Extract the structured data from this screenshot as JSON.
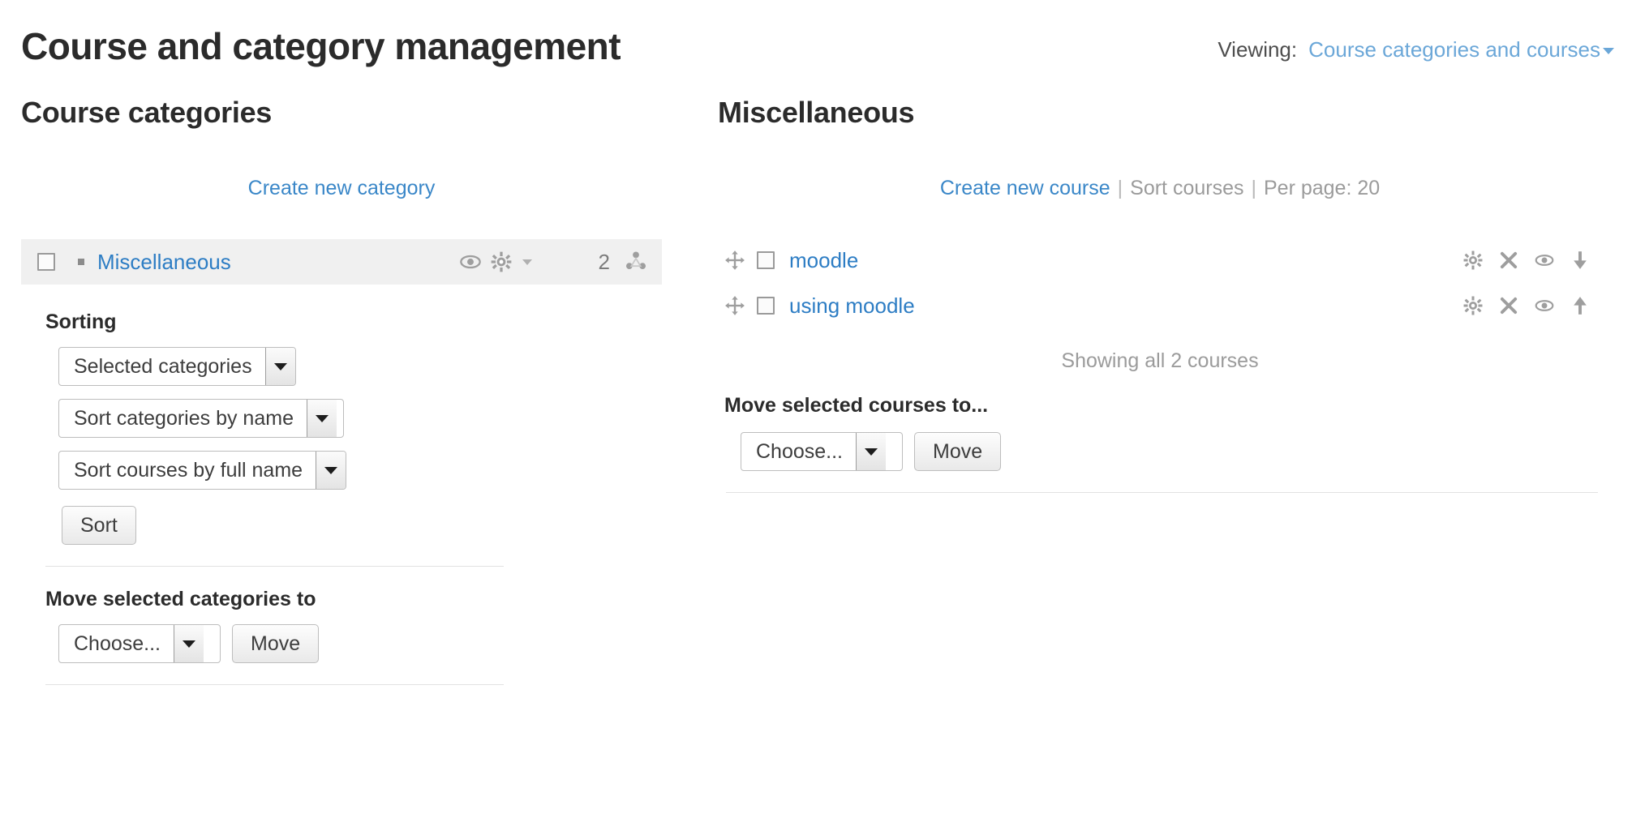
{
  "header": {
    "title": "Course and category management",
    "viewing_label": "Viewing:",
    "viewing_value": "Course categories and courses"
  },
  "categories_panel": {
    "heading": "Course categories",
    "create_link": "Create new category",
    "rows": [
      {
        "name": "Miscellaneous",
        "course_count": "2",
        "selected": true
      }
    ],
    "sorting": {
      "heading": "Sorting",
      "select_scope": "Selected categories",
      "select_categories_by": "Sort categories by name",
      "select_courses_by": "Sort courses by full name",
      "sort_button": "Sort"
    },
    "move": {
      "heading": "Move selected categories to",
      "select_value": "Choose...",
      "move_button": "Move"
    }
  },
  "courses_panel": {
    "heading": "Miscellaneous",
    "create_link": "Create new course",
    "sort_link": "Sort courses",
    "per_page_link": "Per page: 20",
    "separator": "|",
    "rows": [
      {
        "name": "moodle",
        "order_direction": "down"
      },
      {
        "name": "using moodle",
        "order_direction": "up"
      }
    ],
    "showing_note": "Showing all 2 courses",
    "move": {
      "heading": "Move selected courses to...",
      "select_value": "Choose...",
      "move_button": "Move"
    }
  },
  "colors": {
    "link": "#2d7dc4",
    "muted": "#9b9b9b",
    "row_selected_bg": "#f0f0f0",
    "icon_gray": "#9e9e9e"
  }
}
